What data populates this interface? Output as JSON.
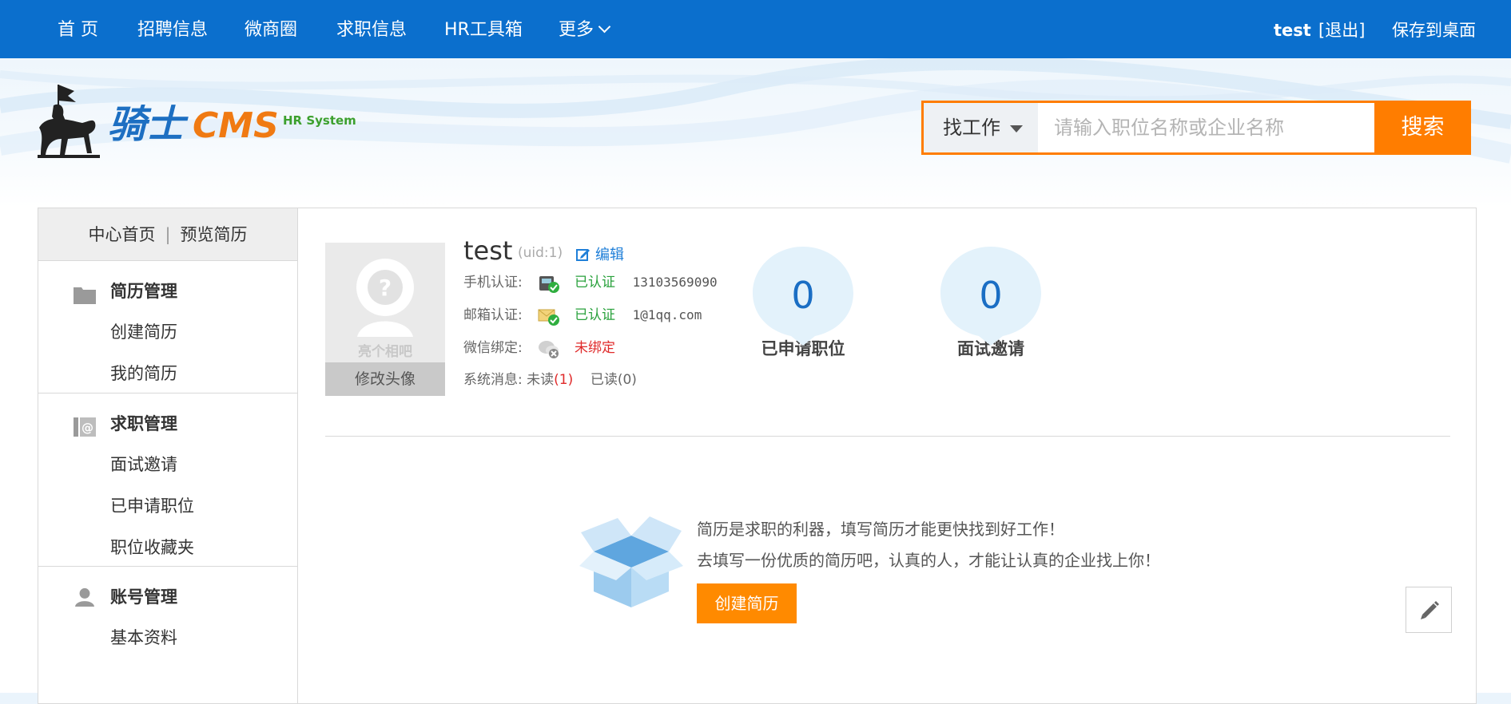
{
  "nav": {
    "items": [
      "首 页",
      "招聘信息",
      "微商圈",
      "求职信息",
      "HR工具箱",
      "更多"
    ],
    "user": "test",
    "logout": "[退出]",
    "save_desktop": "保存到桌面"
  },
  "logo": {
    "brand_cn": "骑士",
    "brand_en": "CMS",
    "tagline": "HR System"
  },
  "search": {
    "type_label": "找工作",
    "placeholder": "请输入职位名称或企业名称",
    "button": "搜索"
  },
  "sidebar": {
    "top_links": [
      "中心首页",
      "预览简历"
    ],
    "separator": "|",
    "sections": [
      {
        "title": "简历管理",
        "icon": "folder-icon",
        "links": [
          "创建简历",
          "我的简历"
        ]
      },
      {
        "title": "求职管理",
        "icon": "at-mail-icon",
        "links": [
          "面试邀请",
          "已申请职位",
          "职位收藏夹"
        ]
      },
      {
        "title": "账号管理",
        "icon": "person-icon",
        "links": [
          "基本资料"
        ]
      }
    ]
  },
  "profile": {
    "avatar_hint": "亮个相吧",
    "avatar_button": "修改头像",
    "username": "test",
    "uid": "(uid:1)",
    "edit": "编辑",
    "phone": {
      "label": "手机认证:",
      "status": "已认证",
      "value": "13103569090"
    },
    "email": {
      "label": "邮箱认证:",
      "status": "已认证",
      "value": "1@1qq.com"
    },
    "wechat": {
      "label": "微信绑定:",
      "status": "未绑定"
    },
    "messages": {
      "label": "系统消息:",
      "unread_label": "未读",
      "unread_count": "(1)",
      "read_label": "已读",
      "read_count": "(0)"
    }
  },
  "stats": [
    {
      "value": "0",
      "label": "已申请职位"
    },
    {
      "value": "0",
      "label": "面试邀请"
    }
  ],
  "resume_prompt": {
    "line1": "简历是求职的利器，填写简历才能更快找到好工作！",
    "line2": "去填写一份优质的简历吧，认真的人，才能让认真的企业找上你！",
    "button": "创建简历"
  },
  "colors": {
    "nav_bg": "#0b6fcd",
    "accent": "#ff7d00",
    "ok": "#29a13c",
    "warn": "#e02b2b",
    "link": "#1f7fd8"
  }
}
